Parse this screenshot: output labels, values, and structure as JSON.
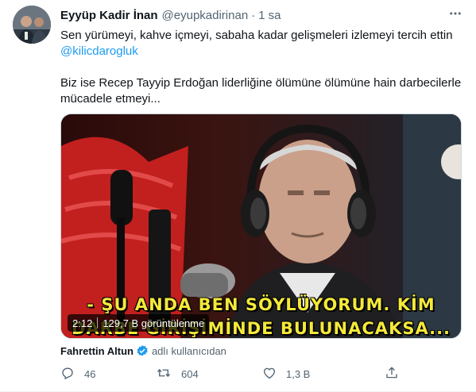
{
  "tweet": {
    "display_name": "Eyyüp Kadir İnan",
    "handle": "@eyupkadirinan",
    "separator": "·",
    "time": "1 sa",
    "text_line1": "Sen yürümeyi, kahve içmeyi, sabaha kadar gelişmeleri izlemeyi tercih ettin",
    "mention": "@kilicdarogluk",
    "text_line3": "Biz ise Recep Tayyip Erdoğan liderliğine ölümüne ölümüne hain darbecilerle",
    "text_line4": "mücadele etmeyi..."
  },
  "media": {
    "subtitle_line1": "- ŞU ANDA BEN SÖYLÜYORUM. KİM",
    "subtitle_line2": "DARBE GİRİŞİMİNDE BULUNACAKSA...",
    "duration": "2:12",
    "views": "129,7 B görüntülenme"
  },
  "attribution": {
    "name": "Fahrettin Altun",
    "suffix": "adlı kullanıcıdan"
  },
  "actions": {
    "reply_count": "46",
    "retweet_count": "604",
    "like_count": "1,3 B"
  },
  "colors": {
    "accent": "#1d9bf0",
    "secondary_text": "#536471",
    "primary_text": "#0f1419"
  },
  "icons": [
    "more-icon",
    "verified-badge-icon",
    "reply-icon",
    "retweet-icon",
    "like-icon",
    "share-icon"
  ]
}
